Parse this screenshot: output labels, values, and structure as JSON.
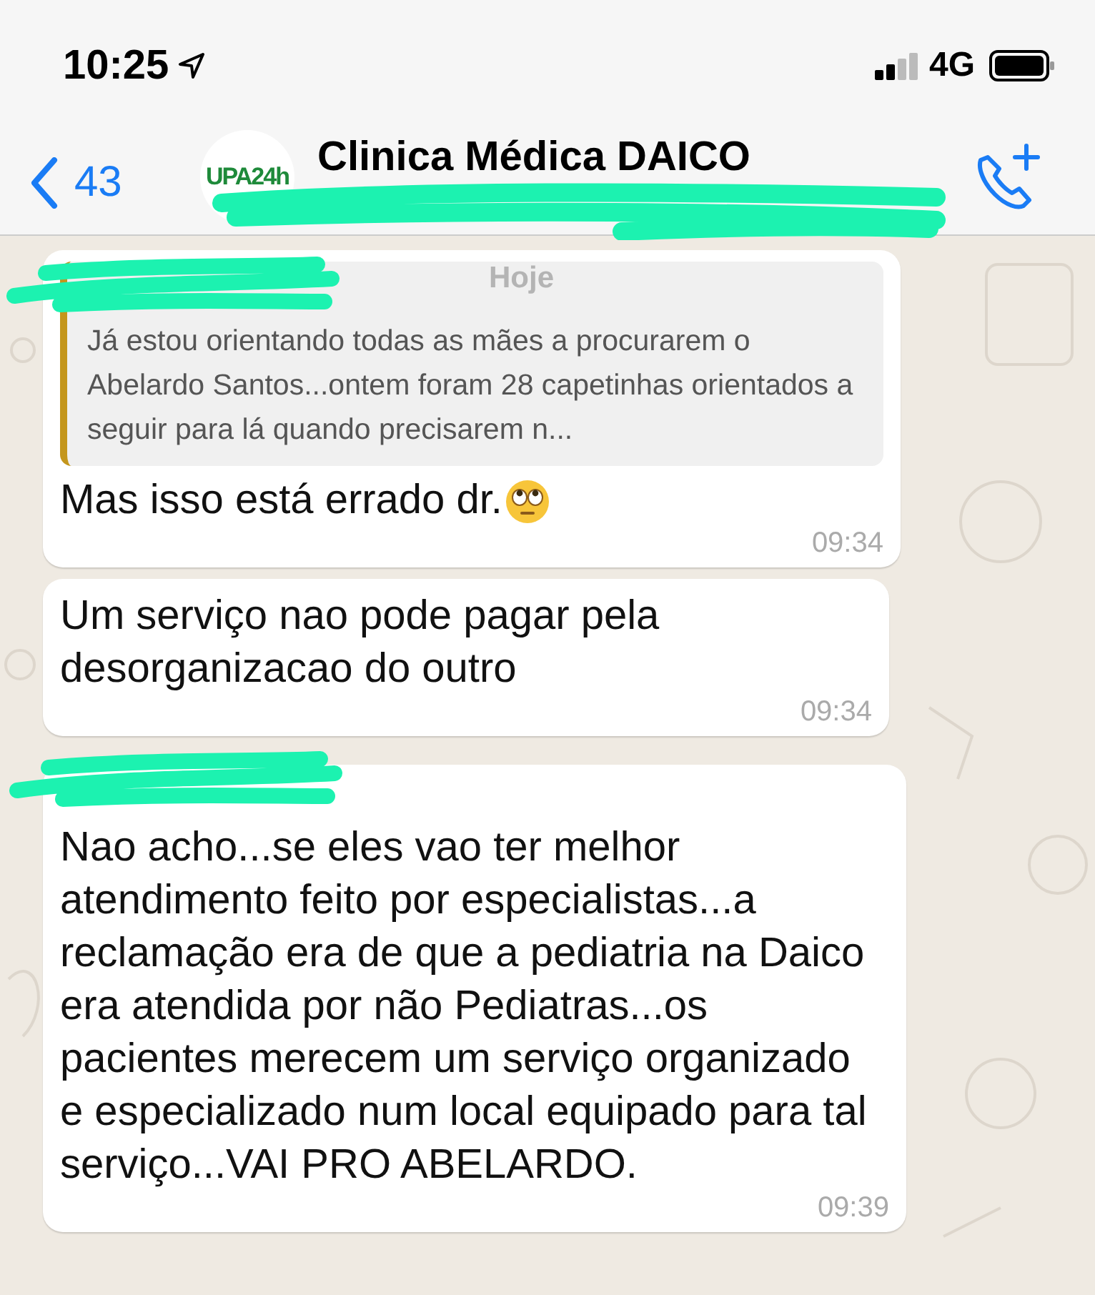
{
  "status_bar": {
    "time": "10:25",
    "network": "4G"
  },
  "header": {
    "back_count": "43",
    "logo_text": "UPA24h",
    "title": "Clinica Médica DAICO"
  },
  "date_label": "Hoje",
  "messages": [
    {
      "kind": "reply",
      "quote": "Já estou orientando todas as mães a procurarem o Abelardo Santos...ontem foram 28 capetinhas orientados a seguir para lá quando precisarem n...",
      "text": "Mas isso está errado dr.",
      "emoji": true,
      "time": "09:34"
    },
    {
      "kind": "plain",
      "text": "Um serviço nao pode pagar pela desorganizacao do outro",
      "emoji": false,
      "time": "09:34"
    },
    {
      "kind": "named",
      "text": "Nao acho...se eles vao ter melhor atendimento feito por especialistas...a reclamação era de que a pediatria na Daico era atendida por não Pediatras...os pacientes merecem um serviço organizado e especializado num local equipado para tal serviço...VAI PRO ABELARDO.",
      "emoji": false,
      "time": "09:39"
    }
  ]
}
